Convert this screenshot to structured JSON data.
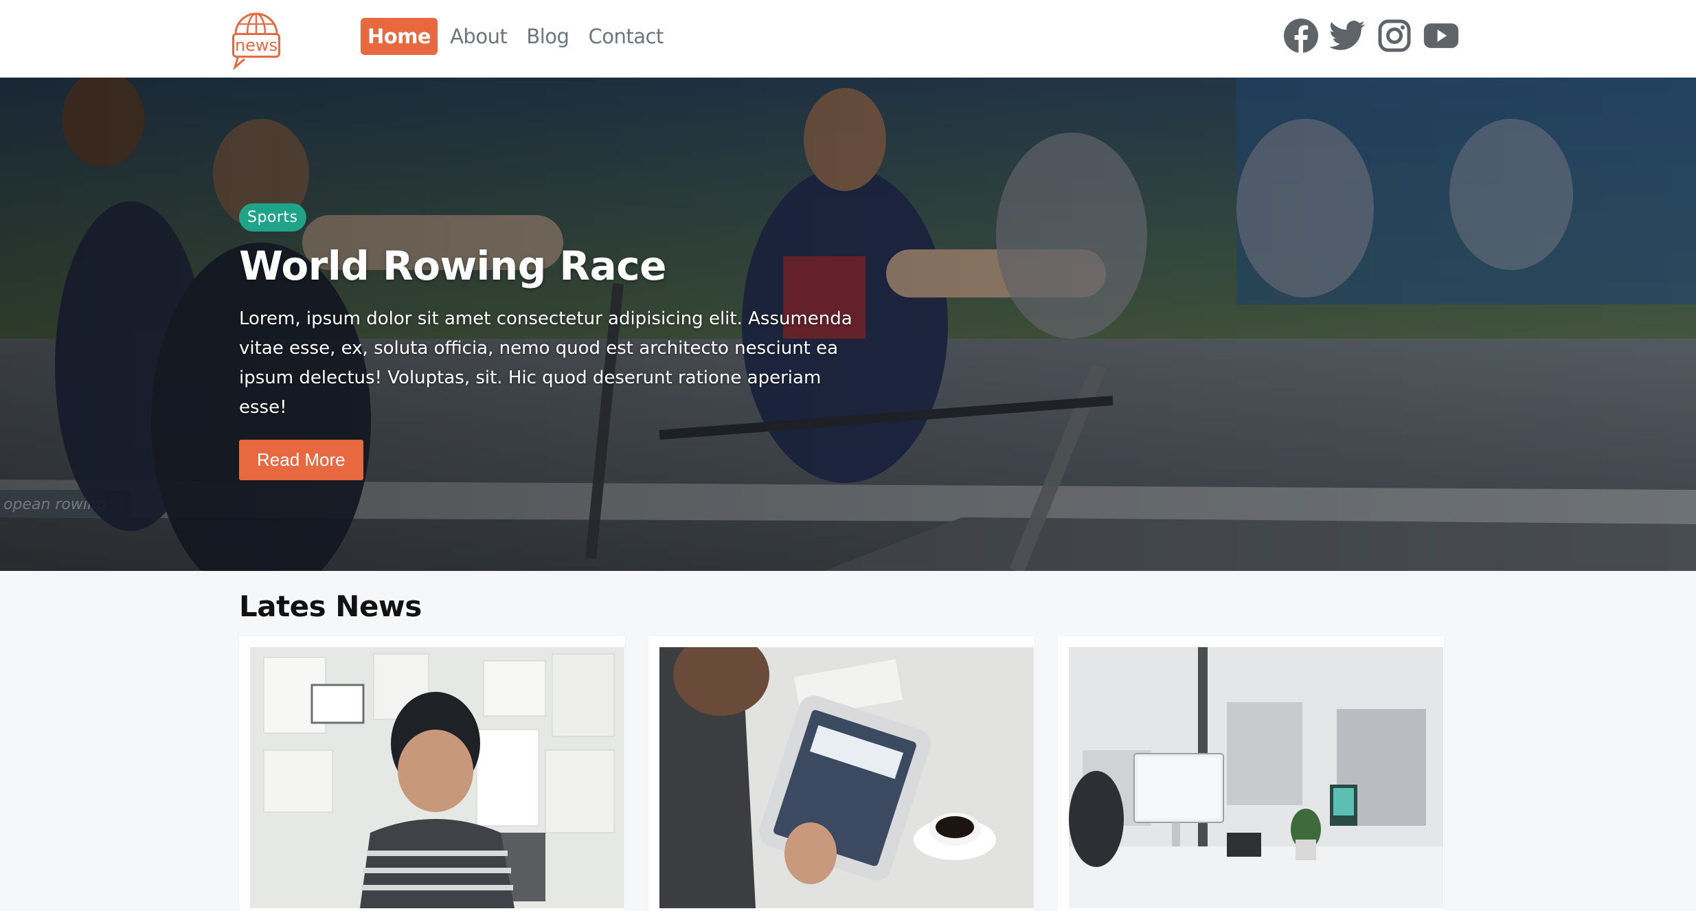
{
  "brand": {
    "logo_text": "news",
    "accent": "#e8693f"
  },
  "nav": {
    "items": [
      {
        "label": "Home",
        "active": true
      },
      {
        "label": "About",
        "active": false
      },
      {
        "label": "Blog",
        "active": false
      },
      {
        "label": "Contact",
        "active": false
      }
    ]
  },
  "socials": [
    {
      "icon": "facebook-icon"
    },
    {
      "icon": "twitter-icon"
    },
    {
      "icon": "instagram-icon"
    },
    {
      "icon": "youtube-icon"
    }
  ],
  "hero": {
    "badge": "Sports",
    "badge_color": "#20a489",
    "title": "World Rowing Race",
    "text": "Lorem, ipsum dolor sit amet consectetur adipisicing elit. Assumenda vitae esse, ex, soluta officia, nemo quod est architecto nesciunt ea ipsum delectus! Voluptas, sit. Hic quod deserunt ratione aperiam esse!",
    "button": "Read More"
  },
  "latest": {
    "title": "Lates News",
    "cards": [
      {
        "image": "man-at-moodboard"
      },
      {
        "image": "man-with-tablet-coffee"
      },
      {
        "image": "office-desk-imac"
      }
    ]
  }
}
